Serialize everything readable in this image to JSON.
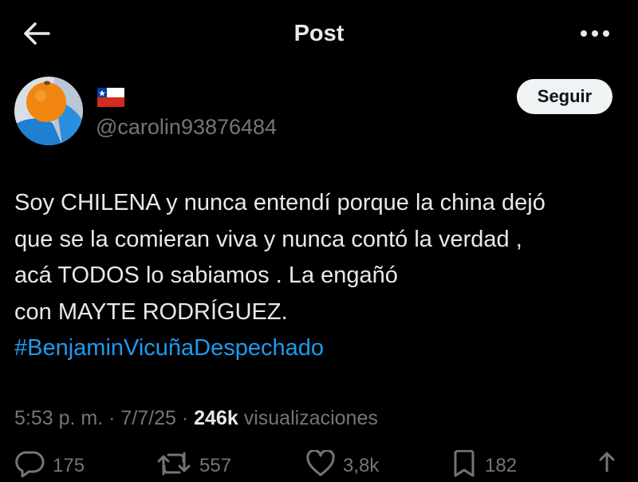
{
  "header": {
    "title": "Post",
    "back_icon": "arrow-left-icon",
    "more_icon": "more-horizontal-icon"
  },
  "author": {
    "flag_icon": "chile-flag-icon",
    "handle": "@carolin93876484",
    "follow_label": "Seguir"
  },
  "tweet": {
    "lines": [
      "Soy CHILENA y nunca entendí porque la china dejó",
      "que se la comieran viva y nunca contó la verdad ,",
      "acá TODOS lo sabiamos . La engañó",
      "con MAYTE RODRÍGUEZ."
    ],
    "hashtag": "#BenjaminVicuñaDespechado"
  },
  "meta": {
    "time": "5:53 p. m.",
    "separator": " · ",
    "date": "7/7/25",
    "views_count": "246k",
    "views_label": "visualizaciones"
  },
  "actions": {
    "replies": "175",
    "reposts": "557",
    "likes": "3,8k",
    "bookmarks": "182"
  },
  "colors": {
    "background": "#000000",
    "text": "#e7e9ea",
    "secondary": "#71767b",
    "link": "#1d9bf0",
    "follow_bg": "#eff3f4"
  }
}
